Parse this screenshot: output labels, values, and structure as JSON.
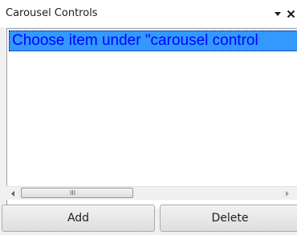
{
  "panel": {
    "title": "Carousel Controls",
    "pin_icon": "dropdown-triangle-icon",
    "close_icon": "close-icon",
    "close_glyph": "×"
  },
  "list": {
    "items": [
      {
        "label": "Choose item under \"carousel control",
        "selected": true
      }
    ],
    "selection_color": "#3399ff",
    "text_color": "#0000ff"
  },
  "scrollbar": {
    "left_icon": "scroll-left-arrow-icon",
    "right_icon": "scroll-right-arrow-icon",
    "grip": "III"
  },
  "buttons": {
    "add_label": "Add",
    "delete_label": "Delete"
  }
}
